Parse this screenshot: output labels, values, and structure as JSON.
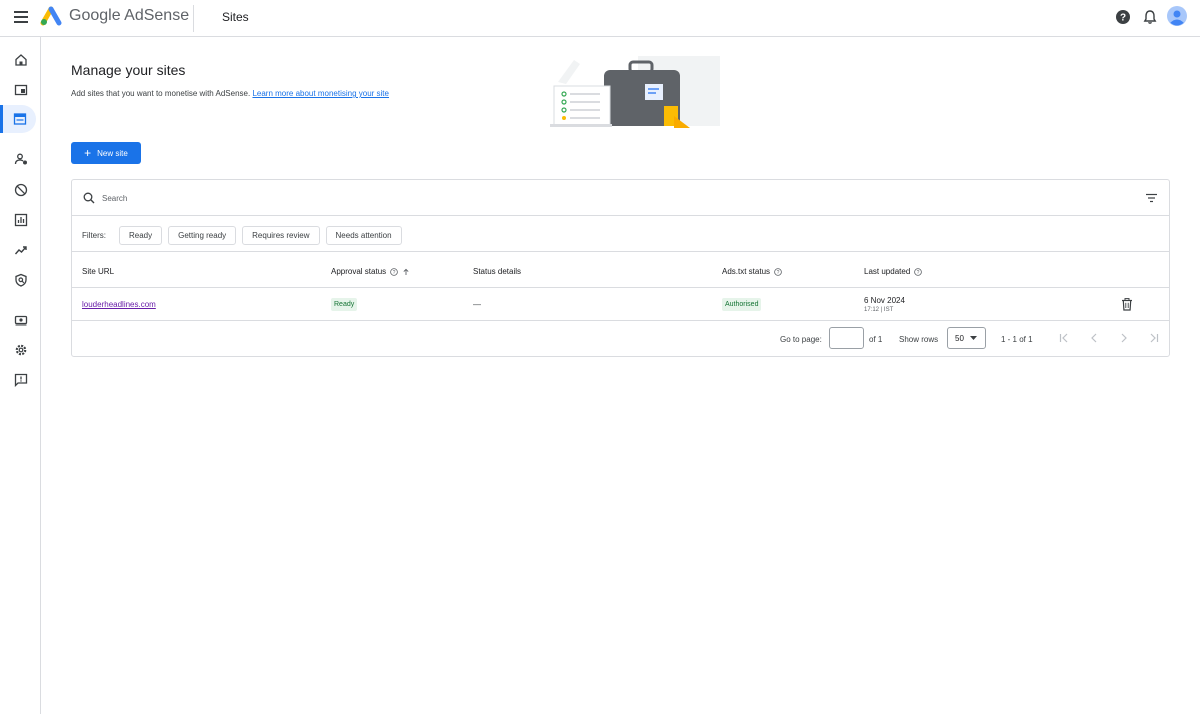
{
  "header": {
    "brand_google": "Google",
    "brand_product": "AdSense",
    "page_title": "Sites",
    "icons": [
      "menu-icon",
      "help-icon",
      "notifications-icon",
      "account-avatar"
    ]
  },
  "sidebar": {
    "items": [
      {
        "name": "home-icon"
      },
      {
        "name": "ads-icon"
      },
      {
        "name": "sites-icon",
        "active": true
      },
      {
        "name": "privacy-messaging-icon"
      },
      {
        "name": "blocking-controls-icon"
      },
      {
        "name": "reports-icon"
      },
      {
        "name": "optimisation-icon"
      },
      {
        "name": "brand-safety-icon"
      },
      {
        "name": "payments-icon"
      },
      {
        "name": "settings-icon"
      },
      {
        "name": "feedback-icon"
      }
    ]
  },
  "main": {
    "heading": "Manage your sites",
    "subtitle": "Add sites that you want to monetise with AdSense.",
    "learn_more": "Learn more about monetising your site",
    "new_site_label": "New site"
  },
  "table": {
    "search_placeholder": "Search",
    "filters_label": "Filters:",
    "filters": [
      "Ready",
      "Getting ready",
      "Requires review",
      "Needs attention"
    ],
    "columns": [
      "Site URL",
      "Approval status",
      "Status details",
      "Ads.txt status",
      "Last updated"
    ],
    "rows": [
      {
        "site_url": "louderheadlines.com",
        "approval_status": "Ready",
        "status_details": "—",
        "ads_txt_status": "Authorised",
        "last_updated_date": "6 Nov 2024",
        "last_updated_time": "17:12 | IST"
      }
    ],
    "pagination": {
      "go_to_page_label": "Go to page:",
      "page_value": "",
      "of_pages": "of 1",
      "show_rows_label": "Show rows",
      "rows_per_page": "50",
      "range": "1 - 1 of 1"
    }
  },
  "colors": {
    "accent": "#1a73e8",
    "status_green_bg": "#e6f4ea",
    "status_green_text": "#137333",
    "link_visited": "#681da8"
  }
}
